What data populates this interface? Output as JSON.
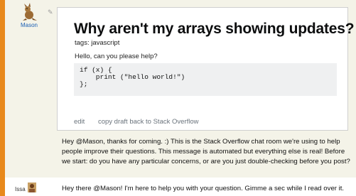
{
  "messages": [
    {
      "author": "Mason",
      "avatar_icon": "kangaroo-icon",
      "draft": {
        "title": "Why aren't my arrays showing updates?",
        "tags": "tags: javascript",
        "body": "Hello, can you please help?",
        "code": "if (x) {\n    print (\"hello world!\")\n};",
        "actions": {
          "edit": "edit",
          "copy_back": "copy draft back to Stack Overflow"
        }
      },
      "text": "Hey @Mason, thanks for coming. :) This is the Stack Overflow chat room we're using to help people improve their questions. This message is automated but everything else is real! Before we start: do you have any particular concerns, or are you just double-checking before you post?"
    },
    {
      "author": "Issa",
      "avatar_icon": "person-avatar-icon",
      "text": "Hey there @Mason! I'm here to help you with your question. Gimme a sec while I read over it."
    }
  ],
  "colors": {
    "outer_background": "#e8891c",
    "highlight_row": "#f4f3e8",
    "username_link": "#1a5fb4",
    "code_background": "#eff0f1"
  }
}
